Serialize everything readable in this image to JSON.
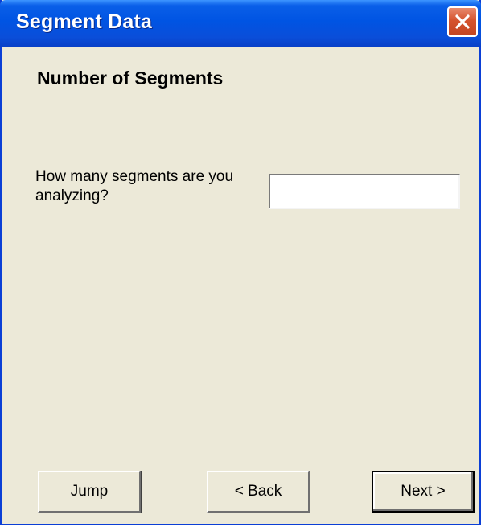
{
  "window": {
    "title": "Segment Data"
  },
  "content": {
    "heading": "Number of Segments",
    "prompt": "How many segments are you analyzing?",
    "segments_input": {
      "value": "",
      "placeholder": ""
    }
  },
  "buttons": {
    "jump": "Jump",
    "back": "< Back",
    "next": "Next >"
  },
  "colors": {
    "titlebar": "#0054e3",
    "dialog_background": "#ece9d8",
    "close_button": "#d5532e"
  },
  "icons": {
    "close": "close-icon"
  }
}
